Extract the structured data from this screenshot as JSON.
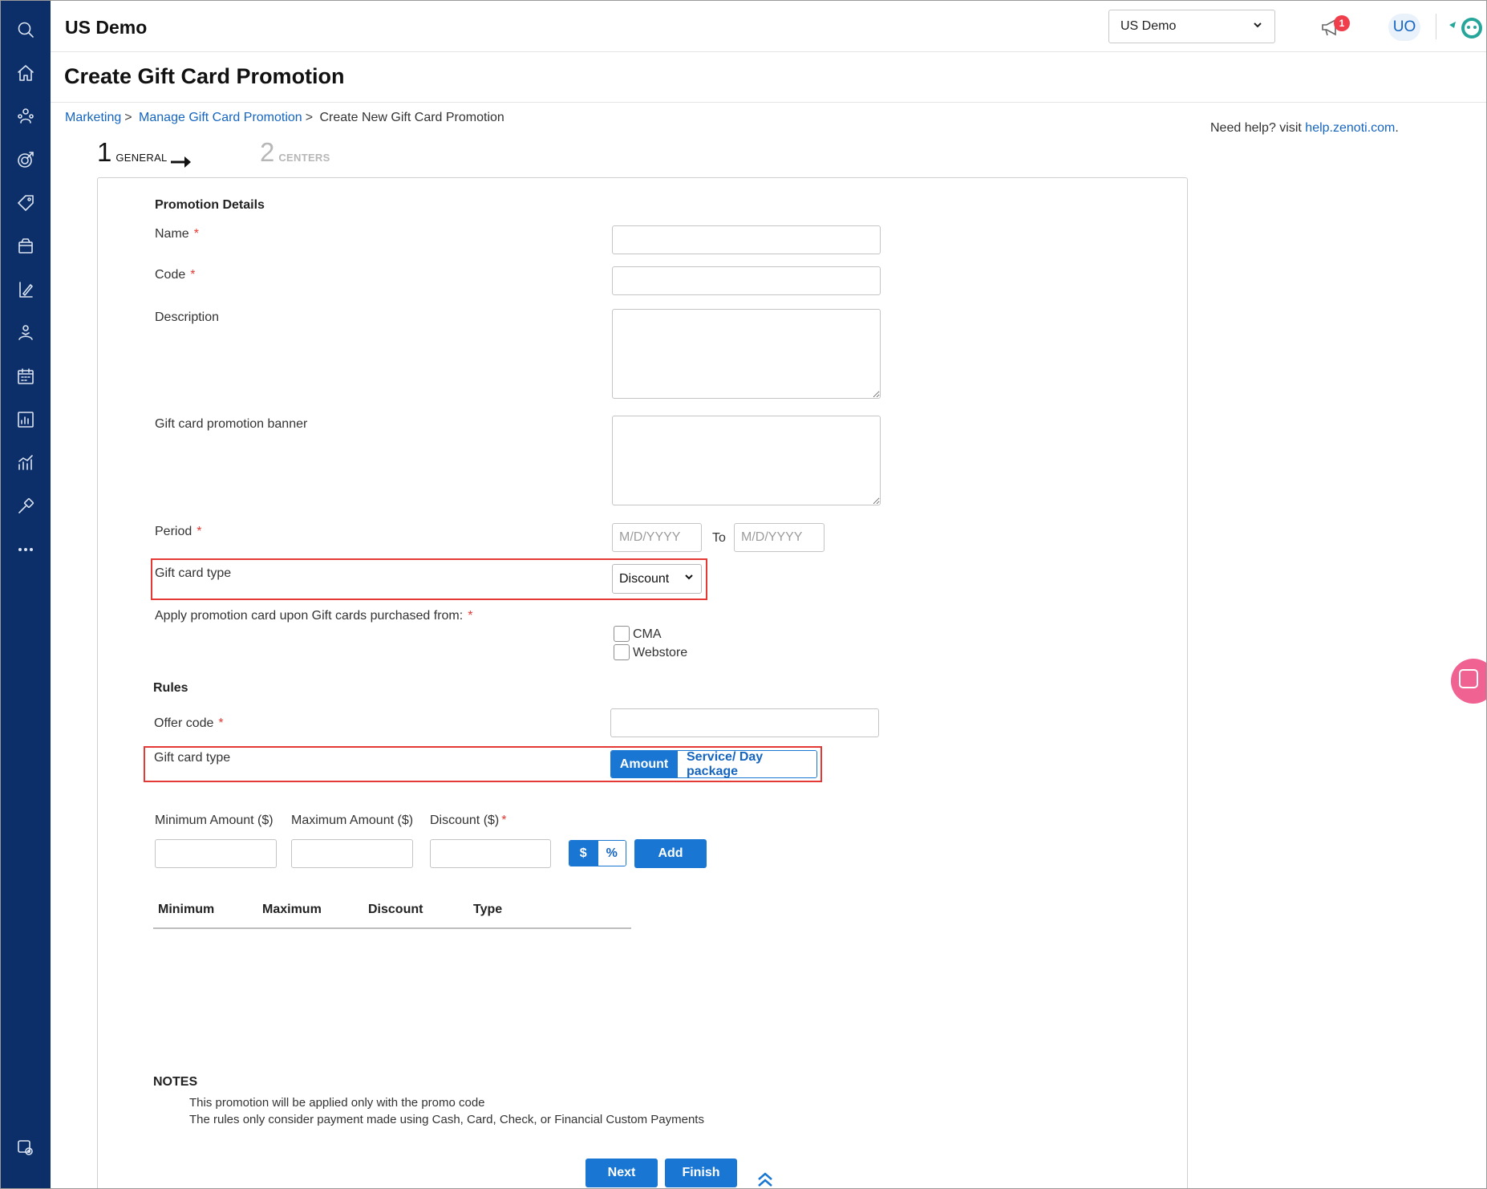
{
  "header": {
    "app_title": "US Demo",
    "center_select": "US Demo",
    "notification_count": "1",
    "user_initials": "UO"
  },
  "page": {
    "title": "Create Gift Card Promotion"
  },
  "breadcrumb": {
    "items": [
      "Marketing",
      "Manage Gift Card Promotion",
      "Create New Gift Card Promotion"
    ],
    "separator": ">"
  },
  "help": {
    "prefix": "Need help? visit",
    "link": "help.zenoti.com",
    "suffix": "."
  },
  "steps": [
    {
      "num": "1",
      "label": "GENERAL"
    },
    {
      "num": "2",
      "label": "CENTERS"
    }
  ],
  "form": {
    "section_details": "Promotion Details",
    "name_label": "Name",
    "code_label": "Code",
    "description_label": "Description",
    "banner_label": "Gift card promotion banner",
    "period_label": "Period",
    "period_from_placeholder": "M/D/YYYY",
    "period_to_label": "To",
    "period_to_placeholder": "M/D/YYYY",
    "gift_card_type_label": "Gift card type",
    "gift_card_type_value": "Discount",
    "apply_label": "Apply promotion card upon Gift cards purchased from:",
    "sources": [
      "CMA",
      "Webstore"
    ],
    "required_mark": "*"
  },
  "rules": {
    "section": "Rules",
    "offer_code_label": "Offer code",
    "gift_card_type_label": "Gift card type",
    "toggle_options": [
      "Amount",
      "Service/ Day package"
    ],
    "min_amount_label": "Minimum Amount ($)",
    "max_amount_label": "Maximum Amount ($)",
    "discount_label": "Discount ($)",
    "currency_options": [
      "$",
      "%"
    ],
    "add_button": "Add",
    "table_headers": [
      "Minimum",
      "Maximum",
      "Discount",
      "Type"
    ]
  },
  "notes": {
    "title": "NOTES",
    "lines": [
      "This promotion will be applied only with the promo code",
      "The rules only consider payment made using Cash, Card, Check, or Financial Custom Payments"
    ]
  },
  "actions": {
    "next": "Next",
    "finish": "Finish"
  },
  "colors": {
    "sidebar": "#0c2f69",
    "primary": "#1976d2",
    "link": "#1565c0",
    "highlight_box": "#e53935",
    "badge": "#ef3f4c",
    "chat": "#f06292"
  }
}
